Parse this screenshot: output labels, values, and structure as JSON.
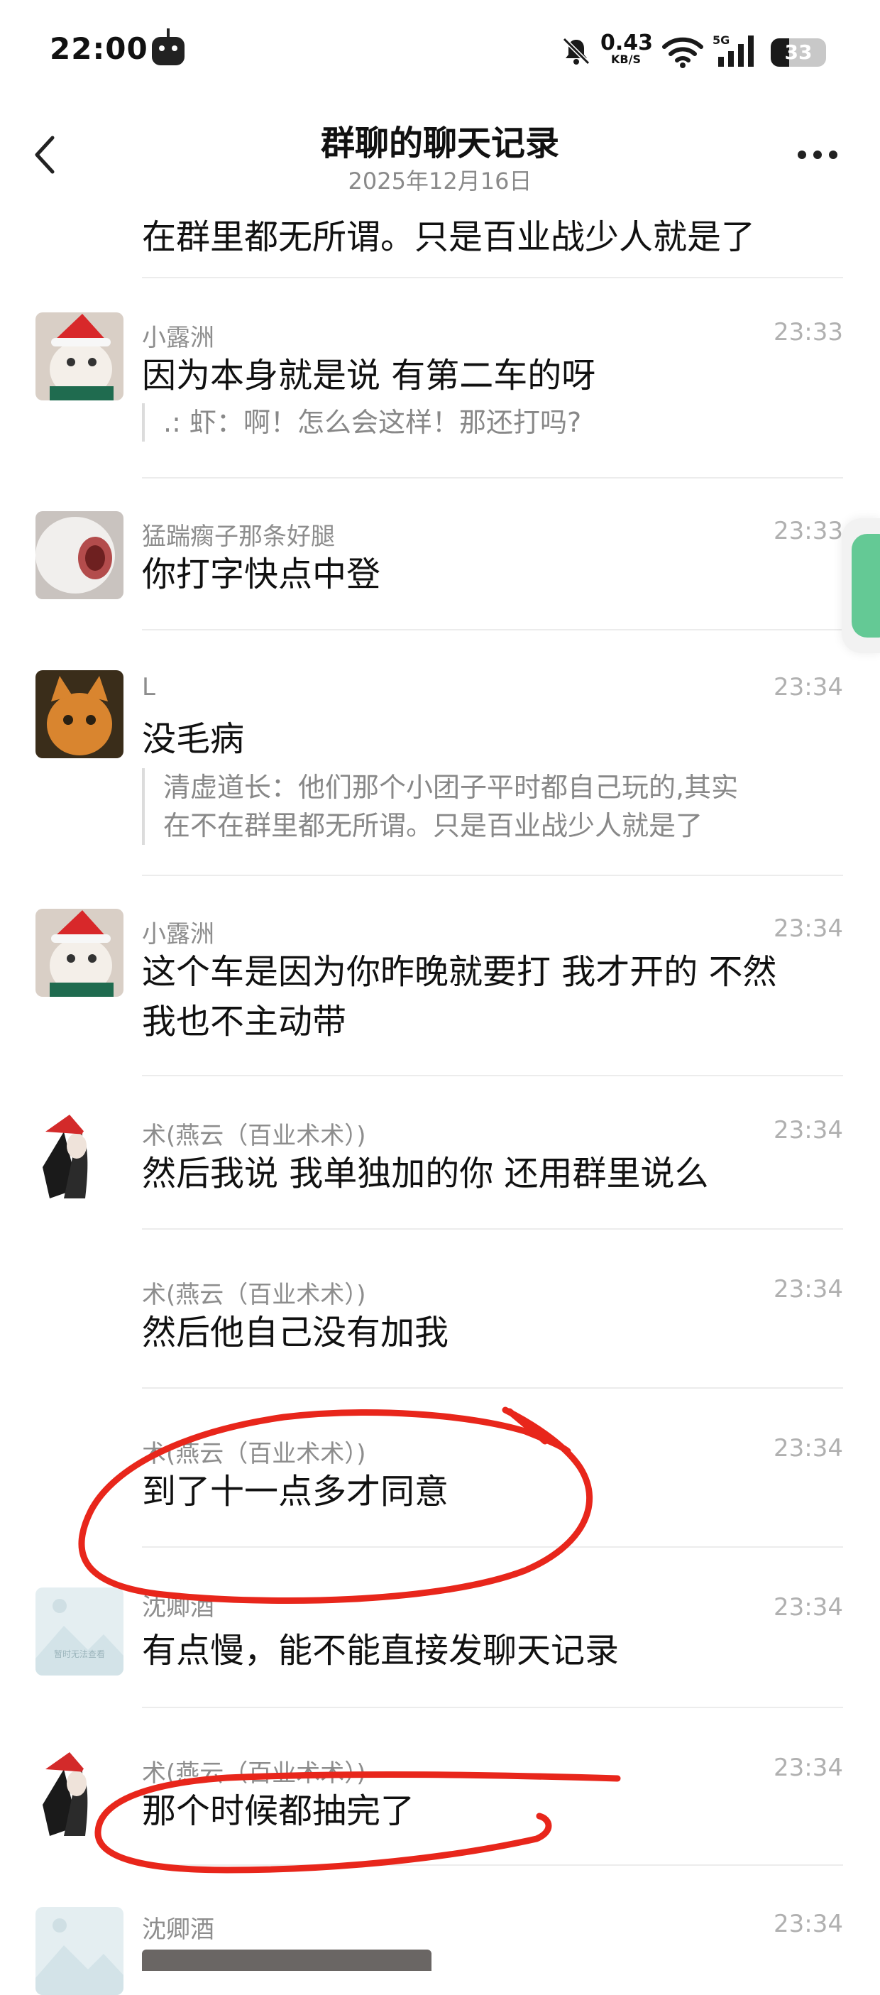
{
  "status_bar": {
    "time": "22:00",
    "net_speed_value": "0.43",
    "net_speed_unit": "KB/S",
    "signal_label": "5G",
    "battery_level": "33",
    "battery_fraction": 0.33
  },
  "header": {
    "title": "群聊的聊天记录",
    "date": "2025年12月16日"
  },
  "top_fragment": "在群里都无所谓。只是百业战少人就是了",
  "messages": [
    {
      "name": "小露洲",
      "time": "23:33",
      "text": "因为本身就是说 有第二车的呀",
      "quote": ".: 虾：啊！怎么会这样！那还打吗?"
    },
    {
      "name": "猛踹瘸子那条好腿",
      "time": "23:33",
      "text": "你打字快点中登"
    },
    {
      "name": "L",
      "time": "23:34",
      "text": "没毛病",
      "quote_line1": "清虚道长：他们那个小团子平时都自己玩的,其实",
      "quote_line2": "在不在群里都无所谓。只是百业战少人就是了"
    },
    {
      "name": "小露洲",
      "time": "23:34",
      "text_line1": "这个车是因为你昨晚就要打 我才开的 不然",
      "text_line2": "我也不主动带"
    },
    {
      "name": "术(燕云（百业术术）)",
      "time": "23:34",
      "text": "然后我说  我单独加的你  还用群里说么"
    },
    {
      "name": "术(燕云（百业术术）)",
      "time": "23:34",
      "text": "然后他自己没有加我"
    },
    {
      "name": "术(燕云（百业术术）)",
      "time": "23:34",
      "text": "到了十一点多才同意"
    },
    {
      "name": "沈卿酒",
      "time": "23:34",
      "text": "有点慢，能不能直接发聊天记录",
      "avatar_caption": "暂时无法查看"
    },
    {
      "name": "术(燕云（百业术术）)",
      "time": "23:34",
      "text": "那个时候都抽完了"
    },
    {
      "name": "沈卿酒",
      "time": "23:34"
    }
  ],
  "colors": {
    "annotation": "#e8261b",
    "float_button": "#64c995",
    "time_gray": "#b0b0b0",
    "name_gray": "#8d8d8d"
  },
  "icons": {
    "back": "chevron-left-icon",
    "more": "more-dots-icon",
    "mute": "bell-off-icon",
    "wifi": "wifi-icon",
    "signal": "signal-bars-icon"
  }
}
